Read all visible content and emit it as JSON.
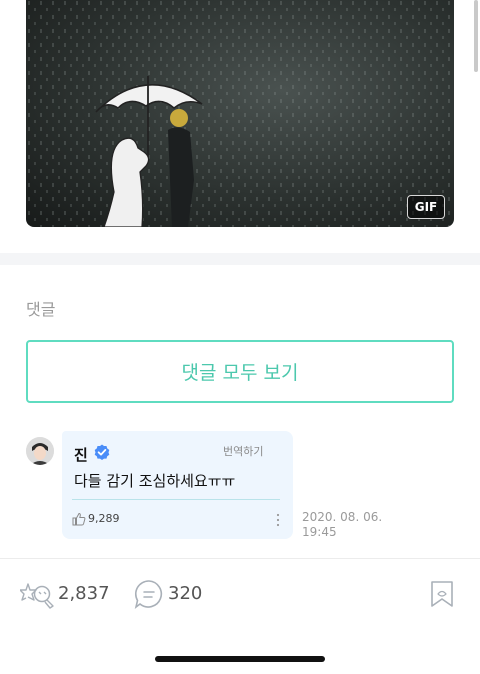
{
  "media": {
    "badge": "GIF"
  },
  "comments": {
    "section_label": "댓글",
    "view_all_label": "댓글 모두 보기",
    "items": [
      {
        "author": "진",
        "verified": true,
        "translate_label": "번역하기",
        "text": "다들 감기 조심하세요ㅠㅠ",
        "likes": "9,289",
        "date": "2020. 08. 06.",
        "time": "19:45"
      }
    ]
  },
  "footer": {
    "reactions_count": "2,837",
    "comments_count": "320"
  },
  "colors": {
    "accent": "#4cc8ad",
    "accent_border": "#5fdcc0",
    "bubble_bg": "#eef6fe",
    "verified": "#4a8df8"
  }
}
